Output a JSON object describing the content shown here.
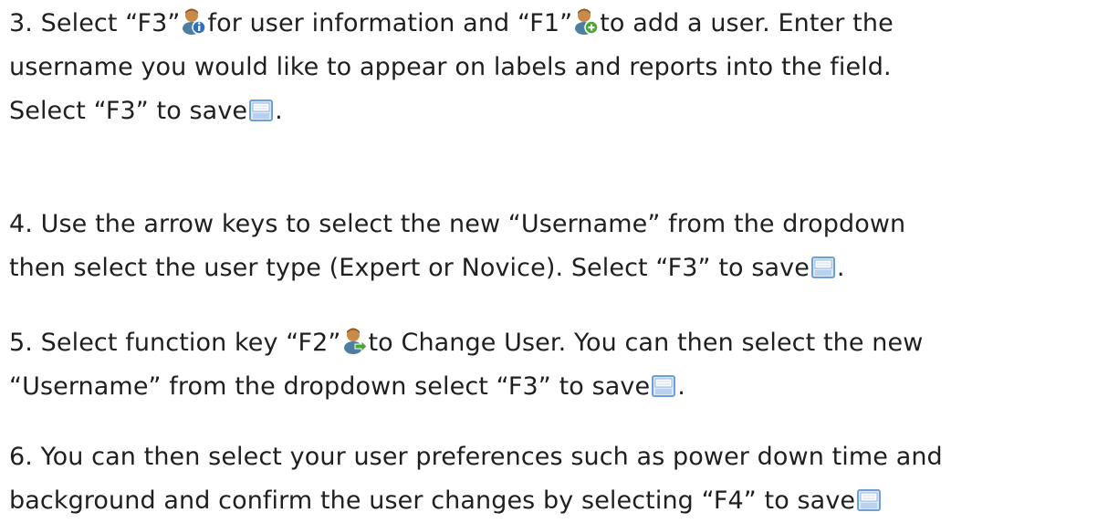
{
  "steps": [
    {
      "lines": [
        [
          "3. Select “F3”",
          "for user information and “F1”",
          "to add a user. Enter the"
        ],
        [
          "username you would like to appear on labels and reports into the field."
        ],
        [
          "Select “F3” to save",
          "."
        ]
      ],
      "icons": [
        "user-info-icon",
        "add-user-icon",
        "save-icon"
      ]
    },
    {
      "lines": [
        [
          "4. Use the arrow keys to select the new “Username” from the dropdown"
        ],
        [
          "then select the user type (Expert or Novice). Select “F3” to save",
          "."
        ]
      ],
      "icons": [
        "save-icon"
      ]
    },
    {
      "lines": [
        [
          "5. Select function key “F2”",
          "to Change User. You can then select the new"
        ],
        [
          "“Username” from the dropdown select “F3” to save",
          "."
        ]
      ],
      "icons": [
        "change-user-icon",
        "save-icon"
      ]
    },
    {
      "lines": [
        [
          "6. You can then select your user preferences such as power down time and"
        ],
        [
          "background and confirm the user changes by selecting “F4” to save"
        ]
      ],
      "icons": [
        "save-icon"
      ]
    }
  ],
  "colors": {
    "text": "#1f1f1f",
    "user_head": "#c98a4a",
    "user_body": "#4c7f9f",
    "info_badge": "#2a6fc0",
    "add_badge": "#4aa832",
    "arrow_badge": "#4aa832",
    "save_border": "#6f9fd8",
    "save_fill": "#dce9f7"
  }
}
